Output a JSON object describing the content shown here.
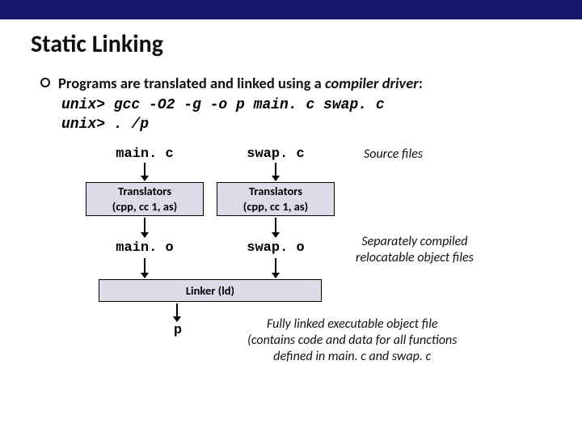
{
  "title": "Static Linking",
  "bullet": {
    "prefix": "Programs are translated and linked using a ",
    "emph": "compiler driver",
    "suffix": ":"
  },
  "cmds": {
    "line1": "unix> gcc -O2 -g -o p main. c swap. c",
    "line2": "unix> . /p"
  },
  "diagram": {
    "source_left": "main. c",
    "source_right": "swap. c",
    "translators": "Translators\n(cpp, cc 1, as)",
    "obj_left": "main. o",
    "obj_right": "swap. o",
    "linker": "Linker (ld)",
    "output": "p"
  },
  "annotations": {
    "source": "Source files",
    "obj": "Separately compiled\nrelocatable object files",
    "exe": "Fully linked executable object file\n(contains code and data for all functions\ndefined in main. c and swap. c"
  }
}
